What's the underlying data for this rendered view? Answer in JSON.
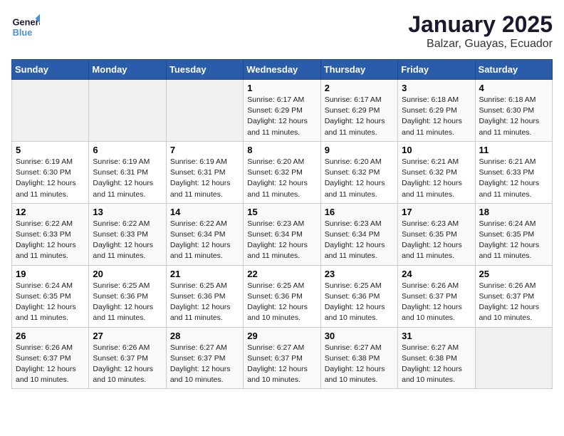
{
  "header": {
    "logo_general": "General",
    "logo_blue": "Blue",
    "month_title": "January 2025",
    "location": "Balzar, Guayas, Ecuador"
  },
  "days_of_week": [
    "Sunday",
    "Monday",
    "Tuesday",
    "Wednesday",
    "Thursday",
    "Friday",
    "Saturday"
  ],
  "weeks": [
    {
      "cells": [
        {
          "day": "",
          "info": ""
        },
        {
          "day": "",
          "info": ""
        },
        {
          "day": "",
          "info": ""
        },
        {
          "day": "1",
          "info": "Sunrise: 6:17 AM\nSunset: 6:29 PM\nDaylight: 12 hours\nand 11 minutes."
        },
        {
          "day": "2",
          "info": "Sunrise: 6:17 AM\nSunset: 6:29 PM\nDaylight: 12 hours\nand 11 minutes."
        },
        {
          "day": "3",
          "info": "Sunrise: 6:18 AM\nSunset: 6:29 PM\nDaylight: 12 hours\nand 11 minutes."
        },
        {
          "day": "4",
          "info": "Sunrise: 6:18 AM\nSunset: 6:30 PM\nDaylight: 12 hours\nand 11 minutes."
        }
      ]
    },
    {
      "cells": [
        {
          "day": "5",
          "info": "Sunrise: 6:19 AM\nSunset: 6:30 PM\nDaylight: 12 hours\nand 11 minutes."
        },
        {
          "day": "6",
          "info": "Sunrise: 6:19 AM\nSunset: 6:31 PM\nDaylight: 12 hours\nand 11 minutes."
        },
        {
          "day": "7",
          "info": "Sunrise: 6:19 AM\nSunset: 6:31 PM\nDaylight: 12 hours\nand 11 minutes."
        },
        {
          "day": "8",
          "info": "Sunrise: 6:20 AM\nSunset: 6:32 PM\nDaylight: 12 hours\nand 11 minutes."
        },
        {
          "day": "9",
          "info": "Sunrise: 6:20 AM\nSunset: 6:32 PM\nDaylight: 12 hours\nand 11 minutes."
        },
        {
          "day": "10",
          "info": "Sunrise: 6:21 AM\nSunset: 6:32 PM\nDaylight: 12 hours\nand 11 minutes."
        },
        {
          "day": "11",
          "info": "Sunrise: 6:21 AM\nSunset: 6:33 PM\nDaylight: 12 hours\nand 11 minutes."
        }
      ]
    },
    {
      "cells": [
        {
          "day": "12",
          "info": "Sunrise: 6:22 AM\nSunset: 6:33 PM\nDaylight: 12 hours\nand 11 minutes."
        },
        {
          "day": "13",
          "info": "Sunrise: 6:22 AM\nSunset: 6:33 PM\nDaylight: 12 hours\nand 11 minutes."
        },
        {
          "day": "14",
          "info": "Sunrise: 6:22 AM\nSunset: 6:34 PM\nDaylight: 12 hours\nand 11 minutes."
        },
        {
          "day": "15",
          "info": "Sunrise: 6:23 AM\nSunset: 6:34 PM\nDaylight: 12 hours\nand 11 minutes."
        },
        {
          "day": "16",
          "info": "Sunrise: 6:23 AM\nSunset: 6:34 PM\nDaylight: 12 hours\nand 11 minutes."
        },
        {
          "day": "17",
          "info": "Sunrise: 6:23 AM\nSunset: 6:35 PM\nDaylight: 12 hours\nand 11 minutes."
        },
        {
          "day": "18",
          "info": "Sunrise: 6:24 AM\nSunset: 6:35 PM\nDaylight: 12 hours\nand 11 minutes."
        }
      ]
    },
    {
      "cells": [
        {
          "day": "19",
          "info": "Sunrise: 6:24 AM\nSunset: 6:35 PM\nDaylight: 12 hours\nand 11 minutes."
        },
        {
          "day": "20",
          "info": "Sunrise: 6:25 AM\nSunset: 6:36 PM\nDaylight: 12 hours\nand 11 minutes."
        },
        {
          "day": "21",
          "info": "Sunrise: 6:25 AM\nSunset: 6:36 PM\nDaylight: 12 hours\nand 11 minutes."
        },
        {
          "day": "22",
          "info": "Sunrise: 6:25 AM\nSunset: 6:36 PM\nDaylight: 12 hours\nand 10 minutes."
        },
        {
          "day": "23",
          "info": "Sunrise: 6:25 AM\nSunset: 6:36 PM\nDaylight: 12 hours\nand 10 minutes."
        },
        {
          "day": "24",
          "info": "Sunrise: 6:26 AM\nSunset: 6:37 PM\nDaylight: 12 hours\nand 10 minutes."
        },
        {
          "day": "25",
          "info": "Sunrise: 6:26 AM\nSunset: 6:37 PM\nDaylight: 12 hours\nand 10 minutes."
        }
      ]
    },
    {
      "cells": [
        {
          "day": "26",
          "info": "Sunrise: 6:26 AM\nSunset: 6:37 PM\nDaylight: 12 hours\nand 10 minutes."
        },
        {
          "day": "27",
          "info": "Sunrise: 6:26 AM\nSunset: 6:37 PM\nDaylight: 12 hours\nand 10 minutes."
        },
        {
          "day": "28",
          "info": "Sunrise: 6:27 AM\nSunset: 6:37 PM\nDaylight: 12 hours\nand 10 minutes."
        },
        {
          "day": "29",
          "info": "Sunrise: 6:27 AM\nSunset: 6:37 PM\nDaylight: 12 hours\nand 10 minutes."
        },
        {
          "day": "30",
          "info": "Sunrise: 6:27 AM\nSunset: 6:38 PM\nDaylight: 12 hours\nand 10 minutes."
        },
        {
          "day": "31",
          "info": "Sunrise: 6:27 AM\nSunset: 6:38 PM\nDaylight: 12 hours\nand 10 minutes."
        },
        {
          "day": "",
          "info": ""
        }
      ]
    }
  ]
}
